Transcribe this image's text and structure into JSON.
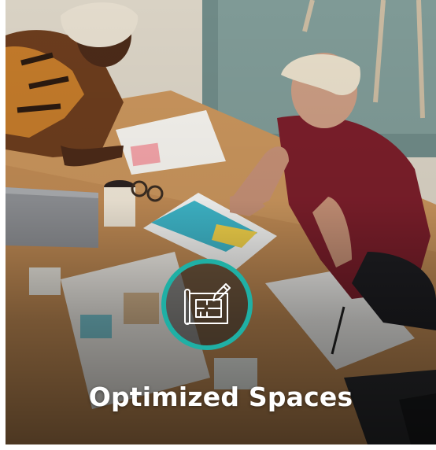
{
  "card": {
    "title": "Optimized Spaces",
    "icon": "blueprint-pencil-icon",
    "accent_color": "#1fb0a5"
  },
  "photo": {
    "subject": "two-people-reviewing-design-plans"
  }
}
